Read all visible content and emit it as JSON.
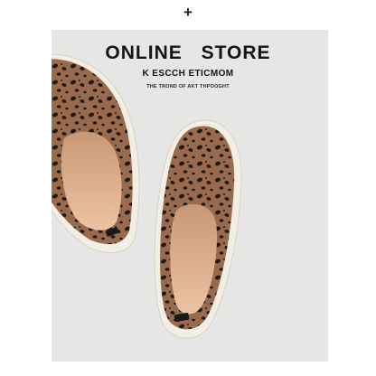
{
  "header": {
    "plus_icon": "plus-icon",
    "plus_glyph": "+"
  },
  "store": {
    "title": "ONLINE  STORE",
    "subtitle": "K ESCCH ETICMOM",
    "tagline": "THE TROND OF AKT THPOOGHT"
  },
  "colors": {
    "panel_background": "#e6e6e4",
    "shoe_knit": "#9a6a4c",
    "leopard_spots": "#1e1a18",
    "insole": "#e6b99a",
    "sole": "#f2eee6"
  }
}
